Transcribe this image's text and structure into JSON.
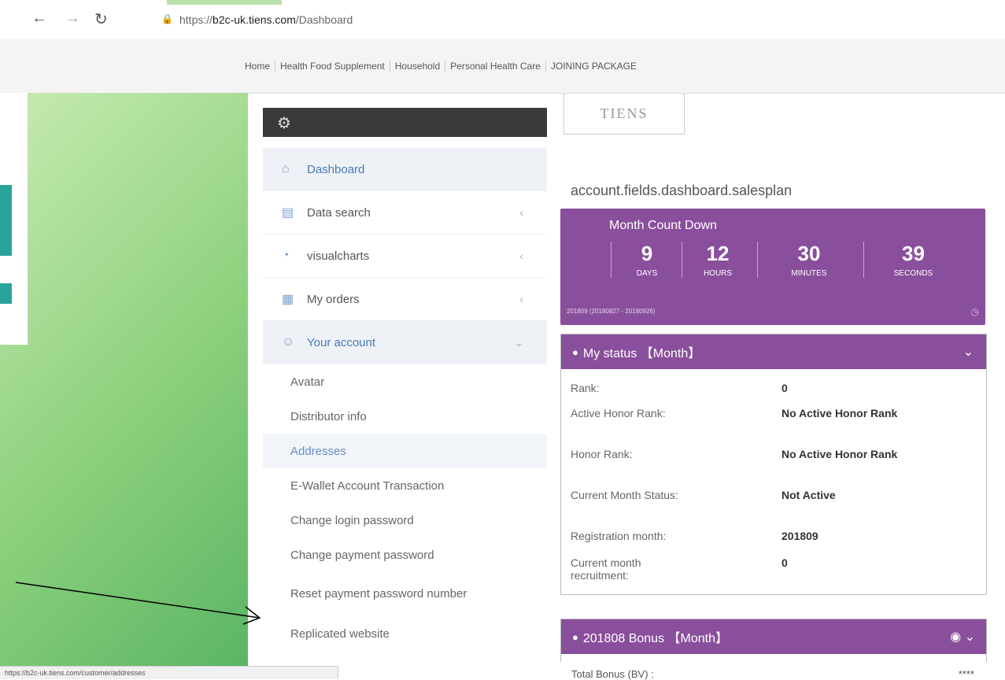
{
  "browser": {
    "url_prefix": "https://",
    "url_host": "b2c-uk.tiens.com",
    "url_path": "/Dashboard",
    "status_url": "https://b2c-uk.tiens.com/customer/addresses"
  },
  "topnav": [
    "Home",
    "Health Food Supplement",
    "Household",
    "Personal Health Care",
    "JOINING PACKAGE"
  ],
  "logo": "TIENS",
  "sidebar": {
    "items": [
      {
        "label": "Dashboard",
        "icon": "home-icon"
      },
      {
        "label": "Data search",
        "icon": "bar-chart-icon"
      },
      {
        "label": "visualcharts",
        "icon": "pie-chart-icon"
      },
      {
        "label": "My orders",
        "icon": "calendar-icon"
      },
      {
        "label": "Your account",
        "icon": "user-icon"
      }
    ],
    "sub_items": [
      "Avatar",
      "Distributor info",
      "Addresses",
      "E-Wallet Account Transaction",
      "Change login password",
      "Change payment password",
      "Reset payment password number",
      "Replicated website"
    ]
  },
  "salesplan": "account.fields.dashboard.salesplan",
  "countdown": {
    "title": "Month Count Down",
    "days": "9",
    "days_label": "DAYS",
    "hours": "12",
    "hours_label": "HOURS",
    "minutes": "30",
    "minutes_label": "MINUTES",
    "seconds": "39",
    "seconds_label": "SECONDS",
    "footer": "201809 (20180827 - 20180926)"
  },
  "status": {
    "title": "My status 【Month】",
    "rows": [
      {
        "k": "Rank:",
        "v": "0"
      },
      {
        "k": "Active Honor Rank:",
        "v": "No Active Honor Rank"
      },
      {
        "k": "Honor Rank:",
        "v": "No Active Honor Rank"
      },
      {
        "k": "Current Month Status:",
        "v": "Not Active"
      },
      {
        "k": "Registration month:",
        "v": "201809"
      },
      {
        "k": "Current month recruitment:",
        "v": "0"
      }
    ]
  },
  "bonus": {
    "title": "201808 Bonus 【Month】",
    "total_label": "Total Bonus (BV) :",
    "total_value": "****"
  },
  "colors": {
    "purple": "#8a4f9c",
    "sidebar_dark": "#3a3a3a",
    "link_blue": "#4a78b5"
  }
}
